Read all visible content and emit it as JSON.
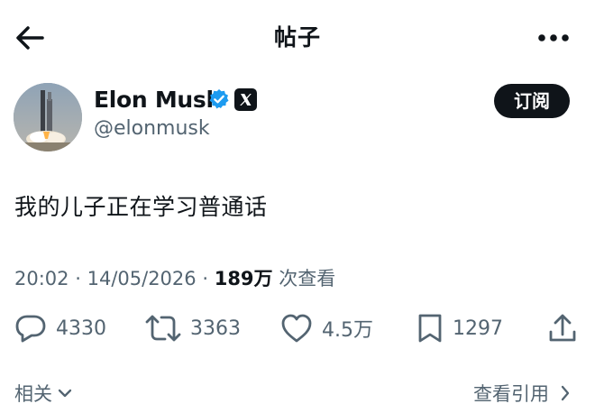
{
  "header": {
    "title": "帖子"
  },
  "author": {
    "name": "Elon Musk",
    "handle": "@elonmusk",
    "badge_letter": "X"
  },
  "subscribe_label": "订阅",
  "post": {
    "text": "我的儿子正在学习普通话",
    "time": "20:02",
    "date": "14/05/2026",
    "views": "189万",
    "views_suffix": "次查看",
    "separator": "·"
  },
  "actions": {
    "replies": "4330",
    "reposts": "3363",
    "likes": "4.5万",
    "bookmarks": "1297"
  },
  "footer": {
    "related_label": "相关",
    "quotes_label": "查看引用"
  },
  "icons": [
    "back-arrow-icon",
    "more-icon",
    "verified-icon",
    "x-logo-icon",
    "reply-icon",
    "repost-icon",
    "like-icon",
    "bookmark-icon",
    "share-icon",
    "chevron-down-icon",
    "chevron-right-icon"
  ],
  "colors": {
    "text": "#0f1419",
    "muted": "#536471",
    "verified": "#1d9bf0",
    "button": "#0f1419"
  }
}
